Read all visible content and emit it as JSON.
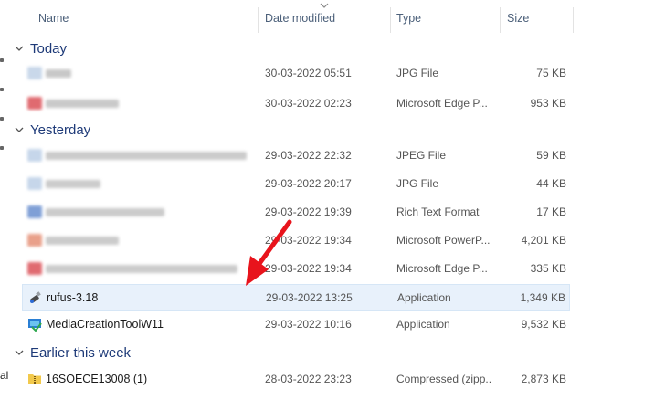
{
  "columns": {
    "name": "Name",
    "date": "Date modified",
    "type": "Type",
    "size": "Size"
  },
  "groups": [
    {
      "label": "Today"
    },
    {
      "label": "Yesterday"
    },
    {
      "label": "Earlier this week"
    }
  ],
  "today_rows": [
    {
      "date": "30-03-2022 05:51",
      "type": "JPG File",
      "size": "75 KB",
      "icon": "blurred-image-icon"
    },
    {
      "date": "30-03-2022 02:23",
      "type": "Microsoft Edge P...",
      "size": "953 KB",
      "icon": "blurred-edge-icon"
    }
  ],
  "yesterday_rows": [
    {
      "date": "29-03-2022 22:32",
      "type": "JPEG File",
      "size": "59 KB"
    },
    {
      "date": "29-03-2022 20:17",
      "type": "JPG File",
      "size": "44 KB"
    },
    {
      "date": "29-03-2022 19:39",
      "type": "Rich Text Format",
      "size": "17 KB"
    },
    {
      "date": "29-03-2022 19:34",
      "type": "Microsoft PowerP...",
      "size": "4,201 KB"
    },
    {
      "date": "29-03-2022 19:34",
      "type": "Microsoft Edge P...",
      "size": "335 KB"
    },
    {
      "name": "rufus-3.18",
      "date": "29-03-2022 13:25",
      "type": "Application",
      "size": "1,349 KB",
      "selected": true
    },
    {
      "name": "MediaCreationToolW11",
      "date": "29-03-2022 10:16",
      "type": "Application",
      "size": "9,532 KB"
    }
  ],
  "week_rows": [
    {
      "name": "16SOECE13008 (1)",
      "date": "28-03-2022 23:23",
      "type": "Compressed (zipp...",
      "size": "2,873 KB"
    }
  ],
  "left_edge_text": "al",
  "colors": {
    "group_label": "#1e3a78",
    "selected_row": "#e8f1fb",
    "annotation_arrow": "#e8141c"
  }
}
